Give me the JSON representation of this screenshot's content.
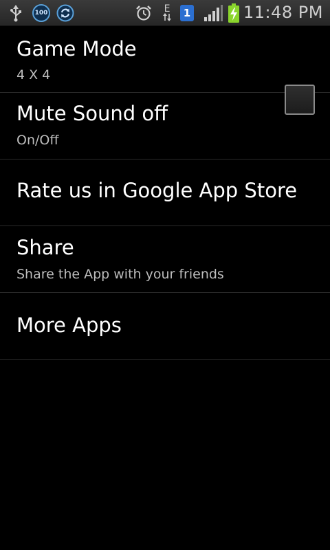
{
  "status_bar": {
    "time": "11:48 PM",
    "badge_100": "100",
    "network_type": "E",
    "sim_slot": "1",
    "icons": [
      "usb-icon",
      "battery-100-icon",
      "sync-icon",
      "alarm-icon",
      "data-transfer-icon",
      "sim-icon",
      "signal-icon",
      "battery-charging-icon"
    ]
  },
  "preferences": {
    "game_mode": {
      "title": "Game Mode",
      "summary": "4 X 4"
    },
    "mute_sound": {
      "title": "Mute Sound off",
      "summary": "On/Off",
      "checked": false
    },
    "rate": {
      "title": "Rate us in Google App Store"
    },
    "share": {
      "title": "Share",
      "summary": "Share the App with your friends"
    },
    "more_apps": {
      "title": "More Apps"
    }
  },
  "colors": {
    "background": "#000000",
    "title_text": "#ffffff",
    "summary_text": "#bdbdbd",
    "divider": "#2a2a2a",
    "status_bar": "#2f2f2f",
    "battery_green": "#8ad42c",
    "sim_blue": "#2b6fd1"
  }
}
